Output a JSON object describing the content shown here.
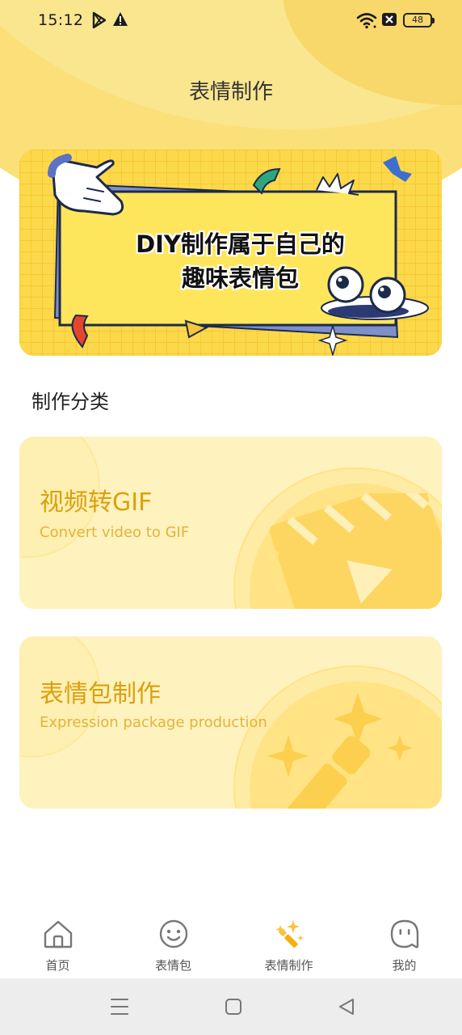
{
  "status_bar": {
    "time": "15:12",
    "battery": "48",
    "icons": [
      "play-store-icon",
      "warning-icon",
      "wifi-icon",
      "no-sim-icon",
      "battery-icon"
    ]
  },
  "header": {
    "title": "表情制作"
  },
  "banner": {
    "line1": "DIY制作属于自己的",
    "line2": "趣味表情包"
  },
  "section": {
    "title": "制作分类"
  },
  "categories": [
    {
      "title": "视频转GIF",
      "subtitle": "Convert video to GIF",
      "icon": "clapperboard-icon"
    },
    {
      "title": "表情包制作",
      "subtitle": "Expression package production",
      "icon": "magic-wand-icon"
    }
  ],
  "tabs": [
    {
      "label": "首页",
      "icon": "home-icon",
      "active": false
    },
    {
      "label": "表情包",
      "icon": "smiley-icon",
      "active": false
    },
    {
      "label": "表情制作",
      "icon": "magic-wand-icon",
      "active": true
    },
    {
      "label": "我的",
      "icon": "profile-face-icon",
      "active": false
    }
  ],
  "system_nav": [
    "menu-icon",
    "home-square-icon",
    "back-triangle-icon"
  ],
  "colors": {
    "accent": "#F7C53A",
    "header_bg": "#FAE27F",
    "card_bg": "#FEF2BE",
    "card_title": "#D9A10D",
    "card_subtitle": "#E3B43A"
  }
}
